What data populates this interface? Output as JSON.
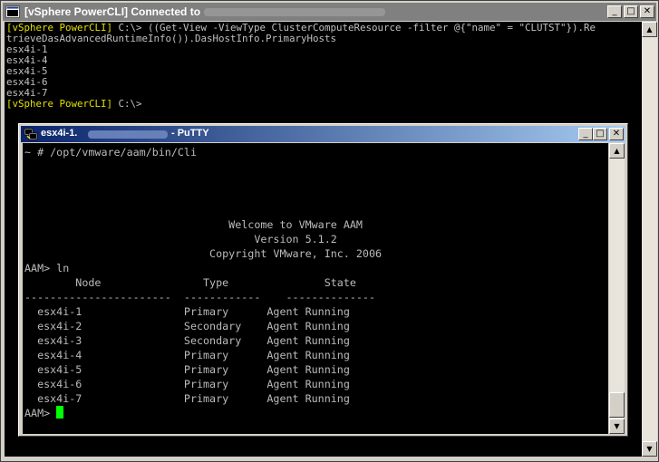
{
  "outer_window": {
    "title": "[vSphere PowerCLI] Connected to",
    "buttons": {
      "minimize": "_",
      "maximize": "□",
      "close": "✕"
    },
    "icon": "powercli-icon"
  },
  "powercli": {
    "prompt": "[vSphere PowerCLI]",
    "command_path": " C:\\> ",
    "command_line1": "((Get-View -ViewType ClusterComputeResource -filter @{\"name\" = \"CLUTST\"}).Re",
    "command_line2": "trieveDasAdvancedRuntimeInfo()).DasHostInfo.PrimaryHosts",
    "output": [
      "esx4i-1",
      "esx4i-4",
      "esx4i-5",
      "esx4i-6",
      "esx4i-7"
    ],
    "final_path": " C:\\>"
  },
  "putty_window": {
    "title_prefix": "esx4i-1.",
    "title_suffix": "- PuTTY",
    "icon": "putty-icon",
    "buttons": {
      "minimize": "_",
      "maximize": "□",
      "close": "✕"
    }
  },
  "terminal": {
    "lines": [
      "~ # /opt/vmware/aam/bin/Cli",
      "",
      "",
      "",
      "",
      "                                Welcome to VMware AAM",
      "                                    Version 5.1.2",
      "                             Copyright VMware, Inc. 2006",
      "AAM> ln",
      "        Node                Type               State",
      "-----------------------  ------------    --------------",
      "  esx4i-1                Primary      Agent Running",
      "  esx4i-2                Secondary    Agent Running",
      "  esx4i-3                Secondary    Agent Running",
      "  esx4i-4                Primary      Agent Running",
      "  esx4i-5                Primary      Agent Running",
      "  esx4i-6                Primary      Agent Running",
      "  esx4i-7                Primary      Agent Running"
    ],
    "prompt": "AAM> "
  },
  "colors": {
    "prompt_yellow": "#e0e000",
    "console_text": "#c0c0c0",
    "cursor_green": "#00ff00",
    "putty_title": "#0a246a"
  }
}
